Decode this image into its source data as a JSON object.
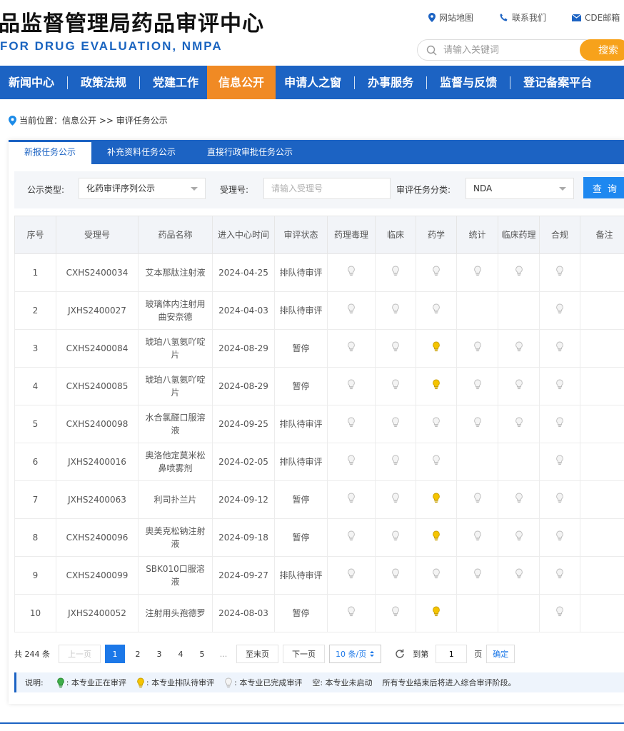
{
  "header": {
    "title": "品监督管理局药品审评中心",
    "subtitle": "FOR DRUG EVALUATION, NMPA",
    "links": [
      {
        "label": "网站地图",
        "icon": "map-pin-icon"
      },
      {
        "label": "联系我们",
        "icon": "phone-icon"
      },
      {
        "label": "CDE邮箱",
        "icon": "mail-icon"
      }
    ],
    "search_placeholder": "请输入关键词",
    "search_button": "搜索"
  },
  "nav": {
    "items": [
      "新闻中心",
      "政策法规",
      "党建工作",
      "信息公开",
      "申请人之窗",
      "办事服务",
      "监督与反馈",
      "登记备案平台"
    ],
    "active_index": 3
  },
  "breadcrumb": "当前位置：信息公开 >> 审评任务公示",
  "tabs": [
    "新报任务公示",
    "补充资料任务公示",
    "直接行政审批任务公示"
  ],
  "filter": {
    "type_label": "公示类型:",
    "type_value": "化药审评序列公示",
    "accept_label": "受理号:",
    "accept_placeholder": "请输入受理号",
    "category_label": "审评任务分类:",
    "category_value": "NDA",
    "query_button": "查 询"
  },
  "table": {
    "headers": [
      "序号",
      "受理号",
      "药品名称",
      "进入中心时间",
      "审评状态",
      "药理毒理",
      "临床",
      "药学",
      "统计",
      "临床药理",
      "合规",
      "备注"
    ],
    "rows": [
      {
        "no": "1",
        "id": "CXHS2400034",
        "name": "艾本那肽注射液",
        "date": "2024-04-25",
        "status": "排队待审评",
        "bulbs": [
          "done",
          "done",
          "done",
          "done",
          "done",
          "done"
        ]
      },
      {
        "no": "2",
        "id": "JXHS2400027",
        "name": "玻璃体内注射用曲安奈德",
        "date": "2024-04-03",
        "status": "排队待审评",
        "bulbs": [
          "done",
          "done",
          "done",
          "",
          "",
          "done"
        ]
      },
      {
        "no": "3",
        "id": "CXHS2400084",
        "name": "琥珀八氢氨吖啶片",
        "date": "2024-08-29",
        "status": "暂停",
        "bulbs": [
          "done",
          "done",
          "queue",
          "done",
          "done",
          "done"
        ]
      },
      {
        "no": "4",
        "id": "CXHS2400085",
        "name": "琥珀八氢氨吖啶片",
        "date": "2024-08-29",
        "status": "暂停",
        "bulbs": [
          "done",
          "done",
          "queue",
          "done",
          "done",
          "done"
        ]
      },
      {
        "no": "5",
        "id": "CXHS2400098",
        "name": "水合氯醛口服溶液",
        "date": "2024-09-25",
        "status": "排队待审评",
        "bulbs": [
          "done",
          "done",
          "done",
          "done",
          "done",
          "done"
        ]
      },
      {
        "no": "6",
        "id": "JXHS2400016",
        "name": "奥洛他定莫米松鼻喷雾剂",
        "date": "2024-02-05",
        "status": "排队待审评",
        "bulbs": [
          "done",
          "done",
          "done",
          "",
          "",
          "done"
        ]
      },
      {
        "no": "7",
        "id": "JXHS2400063",
        "name": "利司扑兰片",
        "date": "2024-09-12",
        "status": "暂停",
        "bulbs": [
          "done",
          "done",
          "queue",
          "done",
          "done",
          "done"
        ]
      },
      {
        "no": "8",
        "id": "CXHS2400096",
        "name": "奥美克松钠注射液",
        "date": "2024-09-18",
        "status": "暂停",
        "bulbs": [
          "done",
          "done",
          "queue",
          "done",
          "done",
          "done"
        ]
      },
      {
        "no": "9",
        "id": "CXHS2400099",
        "name": "SBK010口服溶液",
        "date": "2024-09-27",
        "status": "排队待审评",
        "bulbs": [
          "done",
          "done",
          "done",
          "done",
          "done",
          "done"
        ]
      },
      {
        "no": "10",
        "id": "JXHS2400052",
        "name": "注射用头孢德罗",
        "date": "2024-08-03",
        "status": "暂停",
        "bulbs": [
          "done",
          "done",
          "queue",
          "",
          "",
          "done"
        ]
      }
    ]
  },
  "pager": {
    "total": "共 244 条",
    "prev": "上一页",
    "pages": [
      "1",
      "2",
      "3",
      "4",
      "5"
    ],
    "ellipsis": "...",
    "last": "至末页",
    "next": "下一页",
    "page_size": "10 条/页",
    "goto_label": "到第",
    "goto_value": "1",
    "page_unit": "页",
    "ok": "确定"
  },
  "legend": {
    "title": "说明:",
    "items": [
      {
        "icon": "green-bulb-icon",
        "text": ": 本专业正在审评"
      },
      {
        "icon": "yellow-bulb-icon",
        "text": ": 本专业排队待审评"
      },
      {
        "icon": "gray-bulb-icon",
        "text": ": 本专业已完成审评"
      }
    ],
    "empty_note": "空: 本专业未启动",
    "final_note": "所有专业结束后将进入综合审评阶段。"
  },
  "colors": {
    "nav_blue": "#1c63c3",
    "nav_active": "#f08a24",
    "search_orange": "#f7a21b",
    "query_blue": "#1e88f0",
    "bulb_done": "#bdbdbd",
    "bulb_queue": "#f5c400",
    "bulb_active": "#3fae49"
  }
}
